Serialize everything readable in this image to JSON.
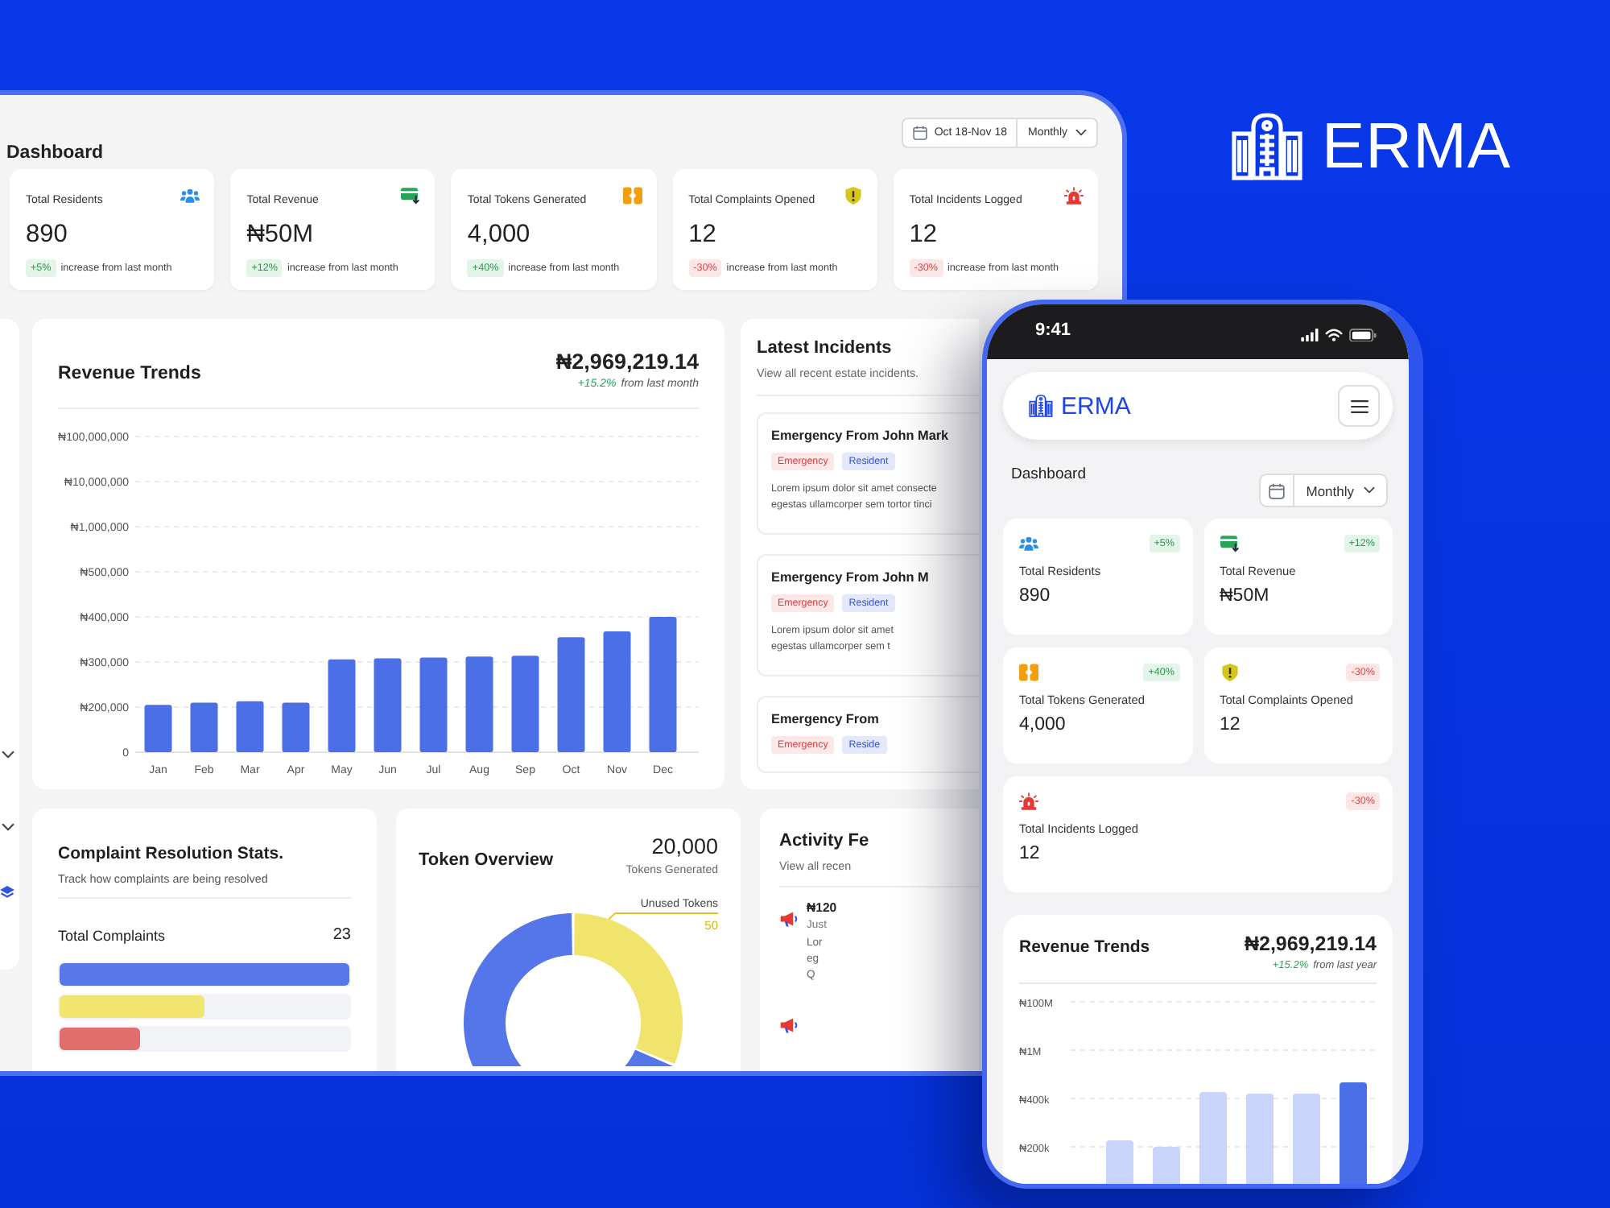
{
  "brand": {
    "name": "ERMA"
  },
  "tablet": {
    "title": "Dashboard",
    "date_range": "Oct 18-Nov 18",
    "period": "Monthly",
    "stats": [
      {
        "kind": "residents",
        "label": "Total Residents",
        "value": "890",
        "change": "+5%",
        "positive": true,
        "note": "increase from last month"
      },
      {
        "kind": "revenue",
        "label": "Total Revenue",
        "value": "₦50M",
        "change": "+12%",
        "positive": true,
        "note": "increase from last month"
      },
      {
        "kind": "tokens",
        "label": "Total Tokens Generated",
        "value": "4,000",
        "change": "+40%",
        "positive": true,
        "note": "increase from last month"
      },
      {
        "kind": "complaints",
        "label": "Total Complaints Opened",
        "value": "12",
        "change": "-30%",
        "positive": false,
        "note": "increase from last month"
      },
      {
        "kind": "incidents",
        "label": "Total Incidents Logged",
        "value": "12",
        "change": "-30%",
        "positive": false,
        "note": "increase from last month"
      }
    ],
    "revenue": {
      "title": "Revenue Trends",
      "amount": "₦2,969,219.14",
      "change": "+15.2%",
      "change_note": "from last month",
      "y_labels": [
        "₦100,000,000",
        "₦10,000,000",
        "₦1,000,000",
        "₦500,000",
        "₦400,000",
        "₦300,000",
        "₦200,000",
        "0"
      ],
      "x_labels": [
        "Jan",
        "Feb",
        "Mar",
        "Apr",
        "May",
        "Jun",
        "Jul",
        "Aug",
        "Sep",
        "Oct",
        "Nov",
        "Dec"
      ]
    },
    "incidents": {
      "title": "Latest Incidents",
      "subtitle": "View all recent estate incidents.",
      "items": [
        {
          "title": "Emergency From John Mark",
          "tags": [
            {
              "kind": "emergency",
              "label": "Emergency"
            },
            {
              "kind": "resident",
              "label": "Resident"
            }
          ],
          "lines": [
            "Lorem ipsum dolor sit amet consecte",
            "egestas ullamcorper sem tortor tinci"
          ]
        },
        {
          "title": "Emergency From John M",
          "tags": [
            {
              "kind": "emergency",
              "label": "Emergency"
            },
            {
              "kind": "resident",
              "label": "Resident"
            }
          ],
          "lines": [
            "Lorem ipsum dolor sit amet",
            "egestas ullamcorper sem t"
          ]
        },
        {
          "title": "Emergency From",
          "tags": [
            {
              "kind": "emergency",
              "label": "Emergency"
            },
            {
              "kind": "resident",
              "label": "Reside"
            }
          ]
        }
      ]
    },
    "complaints": {
      "title": "Complaint Resolution Stats.",
      "subtitle": "Track how complaints are being resolved",
      "total_label": "Total Complaints",
      "total": "23",
      "bars": [
        {
          "color": "#5877e8",
          "level": 1
        },
        {
          "color": "#f2e56f",
          "level": 0.5
        },
        {
          "color": "#e26d6d",
          "level": 0.28
        }
      ]
    },
    "tokens": {
      "title": "Token Overview",
      "total": "20,000",
      "total_label": "Tokens Generated",
      "callout_label": "Unused Tokens",
      "callout_value": "50"
    },
    "activity": {
      "title": "Activity Fe",
      "subtitle": "View all recen",
      "items": [
        {
          "kind": "announcement",
          "amount": "₦120",
          "time": "Just",
          "lines": [
            "Lor",
            "eg",
            "Q"
          ]
        },
        {
          "kind": "announcement"
        }
      ]
    }
  },
  "phone": {
    "time": "9:41",
    "brand": "ERMA",
    "title": "Dashboard",
    "period": "Monthly",
    "stats": [
      {
        "kind": "residents",
        "label": "Total Residents",
        "value": "890",
        "change": "+5%",
        "positive": true
      },
      {
        "kind": "revenue",
        "label": "Total Revenue",
        "value": "₦50M",
        "change": "+12%",
        "positive": true
      },
      {
        "kind": "tokens",
        "label": "Total Tokens Generated",
        "value": "4,000",
        "change": "+40%",
        "positive": true
      },
      {
        "kind": "complaints",
        "label": "Total Complaints Opened",
        "value": "12",
        "change": "-30%",
        "positive": false
      },
      {
        "kind": "incidents",
        "label": "Total Incidents Logged",
        "value": "12",
        "change": "-30%",
        "positive": false
      }
    ],
    "revenue": {
      "title": "Revenue Trends",
      "amount": "₦2,969,219.14",
      "change": "+15.2%",
      "change_note": "from last year",
      "y_labels": [
        "₦100M",
        "₦1M",
        "₦400k",
        "₦200k"
      ],
      "bars": [
        {
          "highlighted": false
        },
        {
          "highlighted": false
        },
        {
          "highlighted": false
        },
        {
          "highlighted": false
        },
        {
          "highlighted": false
        },
        {
          "highlighted": true
        }
      ]
    }
  }
}
